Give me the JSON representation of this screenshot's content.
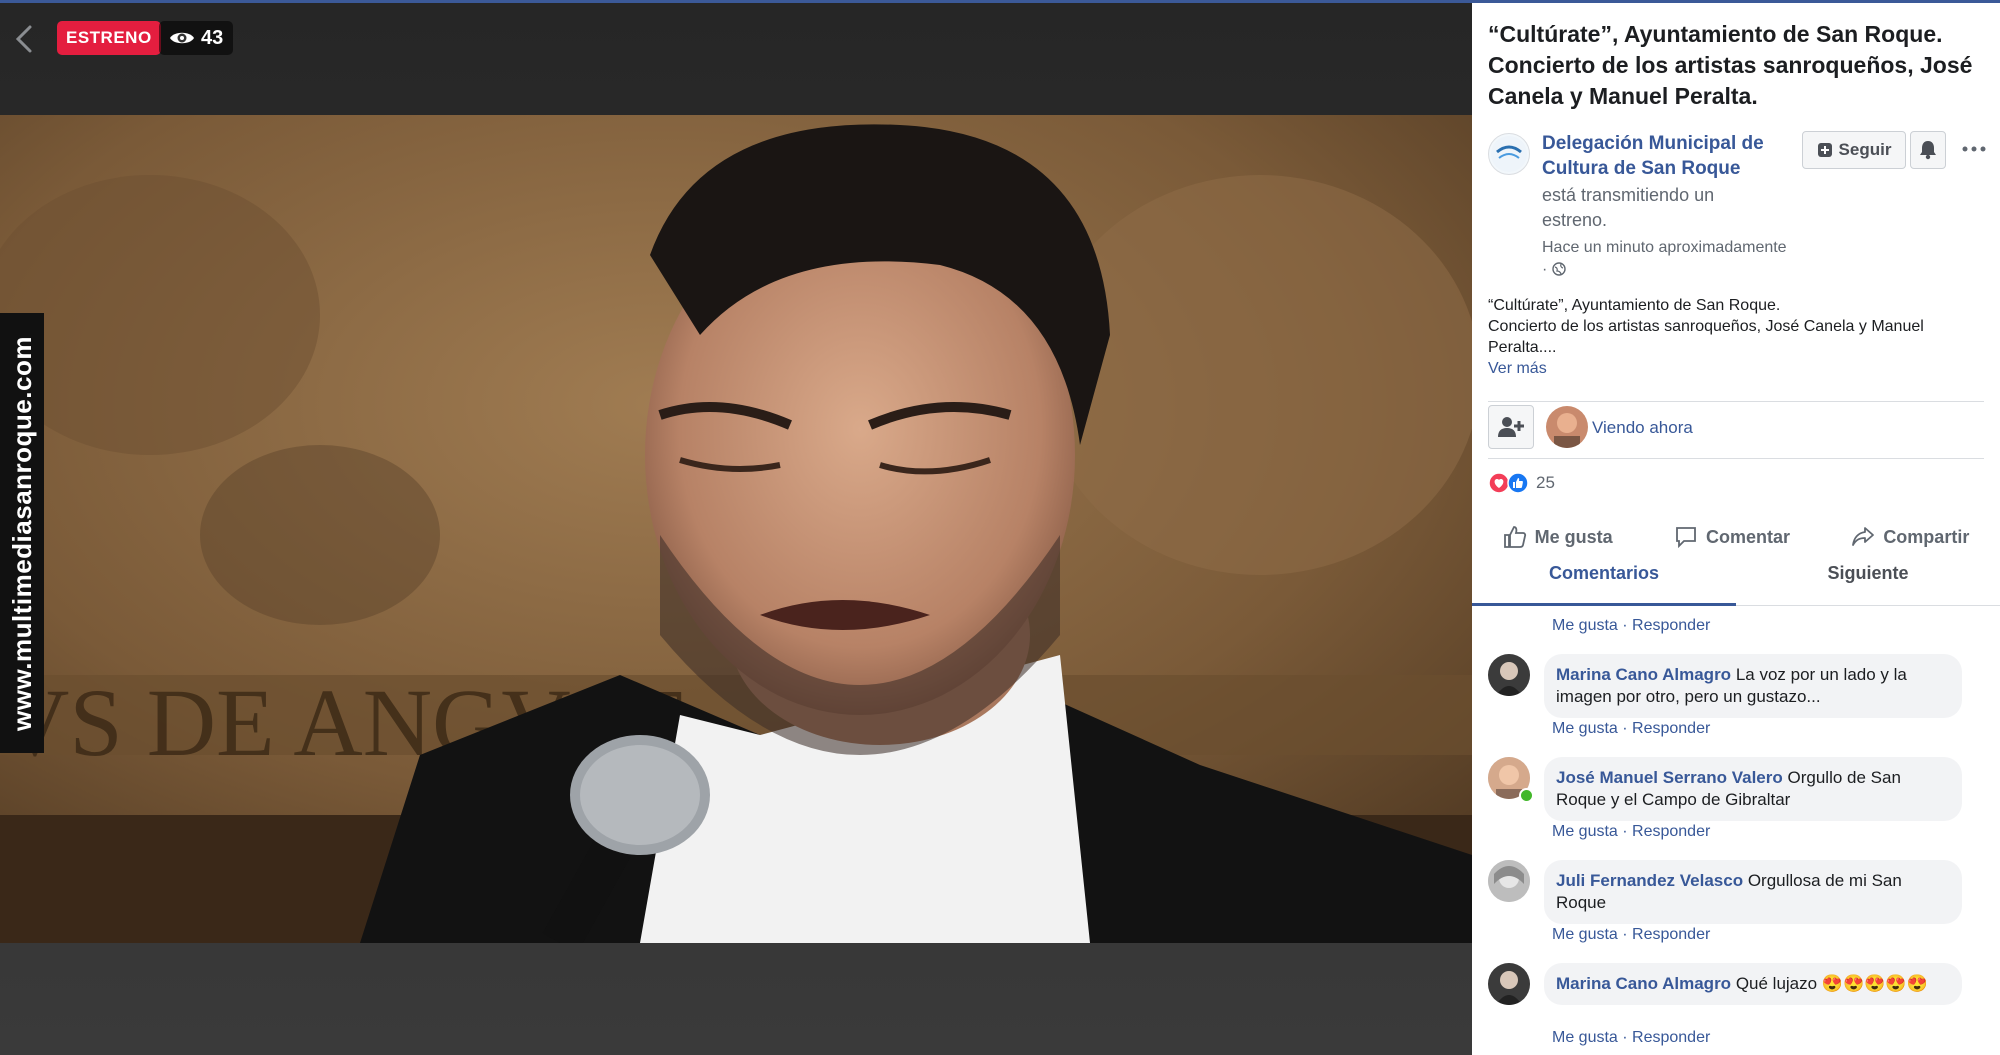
{
  "video": {
    "badge": "ESTRENO",
    "viewers": "43",
    "watermark": "www.multimediasanroque.com"
  },
  "post": {
    "title": "“Cultúrate”, Ayuntamiento de San Roque. Concierto de los artistas sanroqueños, José Canela y Manuel Peralta.",
    "page_name": "Delegación Municipal de Cultura de San Roque",
    "stream_info": "está transmitiendo un estreno.",
    "timestamp": "Hace un minuto aproximadamente",
    "timestamp_sep": "·",
    "follow_label": "Seguir",
    "description_line1": "“Cultúrate”, Ayuntamiento de San Roque.",
    "description_line2": "Concierto de los artistas sanroqueños, José Canela y Manuel Peralta....",
    "see_more": "Ver más",
    "viewing_now": "Viendo ahora",
    "reaction_count": "25"
  },
  "actions": {
    "like": "Me gusta",
    "comment": "Comentar",
    "share": "Compartir"
  },
  "tabs": {
    "comments": "Comentarios",
    "next": "Siguiente"
  },
  "comment_links": {
    "like": "Me gusta",
    "sep": " · ",
    "reply": "Responder"
  },
  "comments": [
    {
      "author": "Marina Cano Almagro",
      "text": "La voz por un lado y la imagen por otro, pero un gustazo..."
    },
    {
      "author": "José Manuel Serrano Valero",
      "text": "Orgullo de San Roque y el Campo de Gibraltar"
    },
    {
      "author": "Juli Fernandez Velasco",
      "text": "Orgullosa de mi San Roque"
    },
    {
      "author": "Marina Cano Almagro",
      "text": "Qué lujazo 😍😍😍😍😍"
    }
  ],
  "colors": {
    "brand": "#385898",
    "badge_red": "#e41e3f",
    "topline": "#3b5998"
  }
}
